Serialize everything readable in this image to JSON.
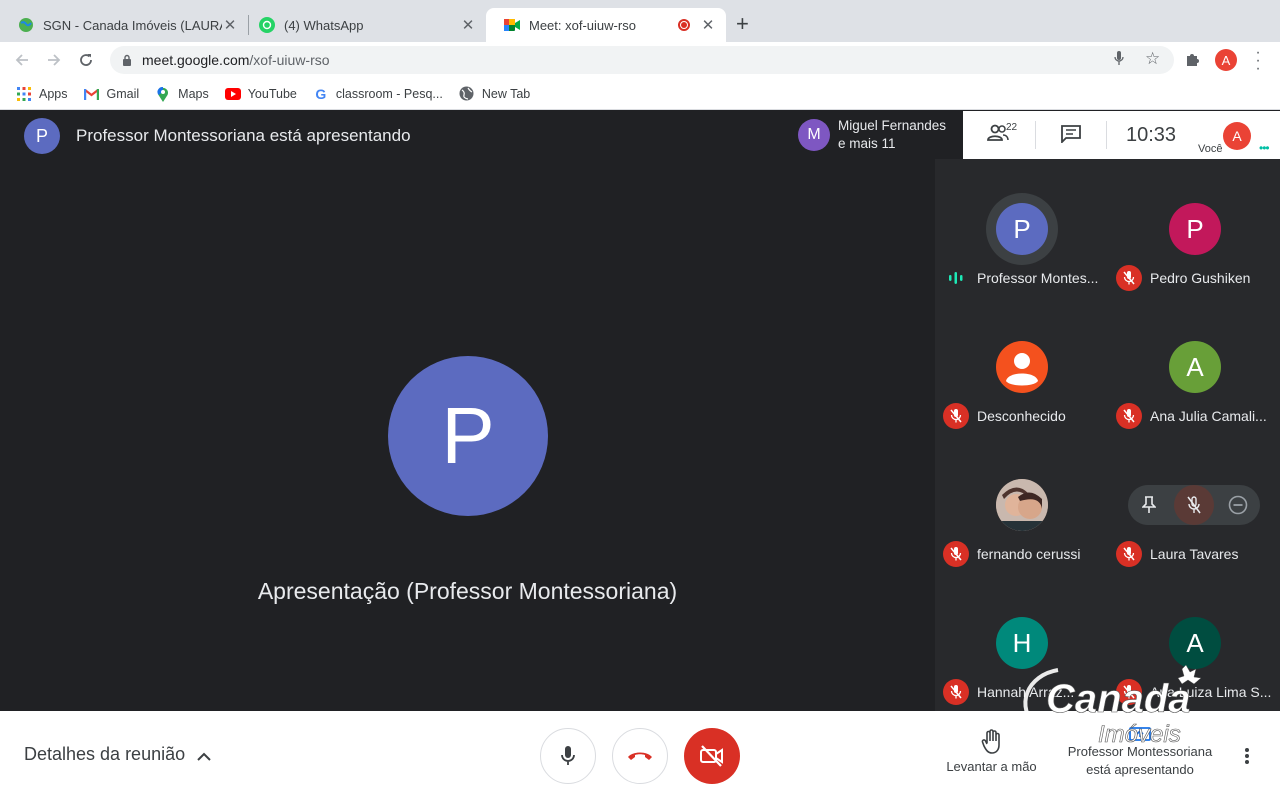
{
  "browser": {
    "tabs": [
      {
        "title": "SGN - Canada Imóveis (LAURA",
        "favicon": "globe-icon",
        "active": false
      },
      {
        "title": "(4) WhatsApp",
        "favicon": "whatsapp-icon",
        "active": false
      },
      {
        "title": "Meet: xof-uiuw-rso",
        "favicon": "meet-icon",
        "active": true
      }
    ],
    "url_host": "meet.google.com",
    "url_path": "/xof-uiuw-rso",
    "profile_initial": "A",
    "bookmarks": [
      {
        "label": "Apps",
        "icon": "apps-grid-icon"
      },
      {
        "label": "Gmail",
        "icon": "gmail-icon"
      },
      {
        "label": "Maps",
        "icon": "maps-pin-icon"
      },
      {
        "label": "YouTube",
        "icon": "youtube-icon"
      },
      {
        "label": "classroom - Pesq...",
        "icon": "google-icon"
      },
      {
        "label": "New Tab",
        "icon": "chrome-globe-icon"
      }
    ]
  },
  "meet": {
    "presenter_initial": "P",
    "presenter_text": "Professor Montessoriana está apresentando",
    "main_initial": "P",
    "main_caption": "Apresentação (Professor Montessoriana)",
    "joiner": {
      "initial": "M",
      "line1": "Miguel Fernandes",
      "line2": "e mais 11"
    },
    "people_count": "22",
    "clock": "10:33",
    "you_initial": "A",
    "you_label": "Você",
    "participants": [
      {
        "initial": "P",
        "name": "Professor Montes...",
        "color": "#5c6bc0",
        "speaking": true
      },
      {
        "initial": "P",
        "name": "Pedro Gushiken",
        "color": "#c2185b",
        "speaking": false
      },
      {
        "initial": "",
        "name": "Desconhecido",
        "color": "#f4511e",
        "speaking": false
      },
      {
        "initial": "A",
        "name": "Ana Julia Camali...",
        "color": "#689f38",
        "speaking": false
      },
      {
        "initial": "",
        "name": "fernando cerussi",
        "color": "#8d6e63",
        "speaking": false
      },
      {
        "initial": "",
        "name": "Laura Tavares",
        "color": "#3c4043",
        "speaking": false
      },
      {
        "initial": "H",
        "name": "Hannah Arraz...",
        "color": "#00897b",
        "speaking": false
      },
      {
        "initial": "A",
        "name": "Ana Luiza Lima S...",
        "color": "#004d40",
        "speaking": false
      }
    ],
    "details_label": "Detalhes da reunião",
    "raise_hand_label": "Levantar a mão",
    "presenting_line1": "Professor Montessoriana",
    "presenting_line2": "está apresentando"
  },
  "watermark": {
    "line1": "Canada",
    "line2": "Imóveis"
  },
  "colors": {
    "accent_red": "#d93025",
    "meet_dark": "#202124",
    "tile_dark": "#28292c"
  }
}
